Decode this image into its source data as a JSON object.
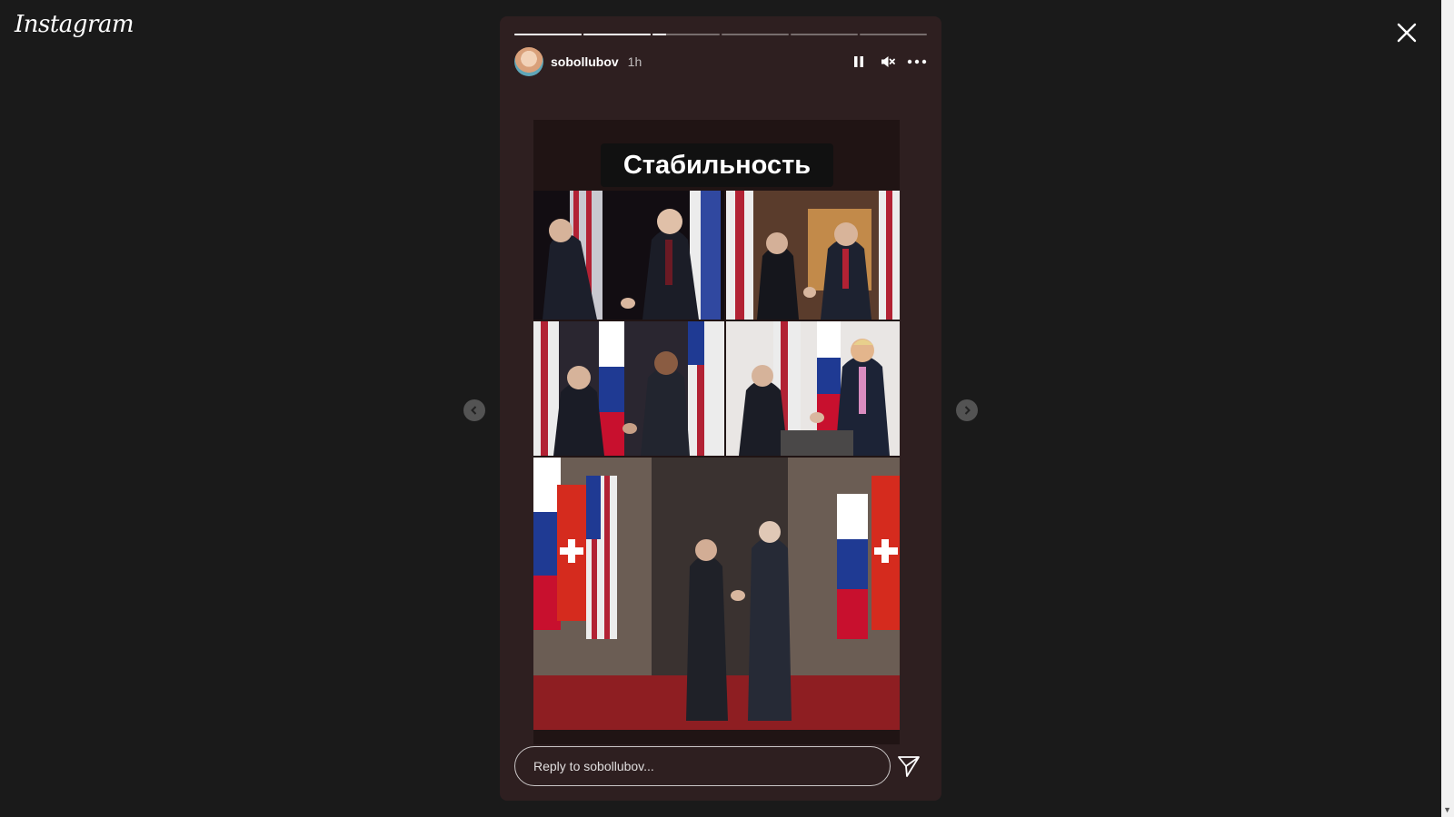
{
  "app": {
    "logo_text": "Instagram"
  },
  "story": {
    "username": "sobollubov",
    "time_ago": "1h",
    "progress_segments": [
      1,
      1,
      0.2,
      0,
      0,
      0
    ],
    "caption_text": "Стабильность",
    "reply_placeholder": "Reply to sobollubov..."
  },
  "icons": {
    "close": "close-icon",
    "pause": "pause-icon",
    "mute": "muted-speaker-icon",
    "more": "more-options-icon",
    "prev": "chevron-left-icon",
    "next": "chevron-right-icon",
    "send": "send-icon"
  },
  "colors": {
    "background": "#1a1a1a",
    "story_bg": "#2e1f20",
    "flag_red": "#b22234",
    "flag_blue": "#1f3a93"
  }
}
